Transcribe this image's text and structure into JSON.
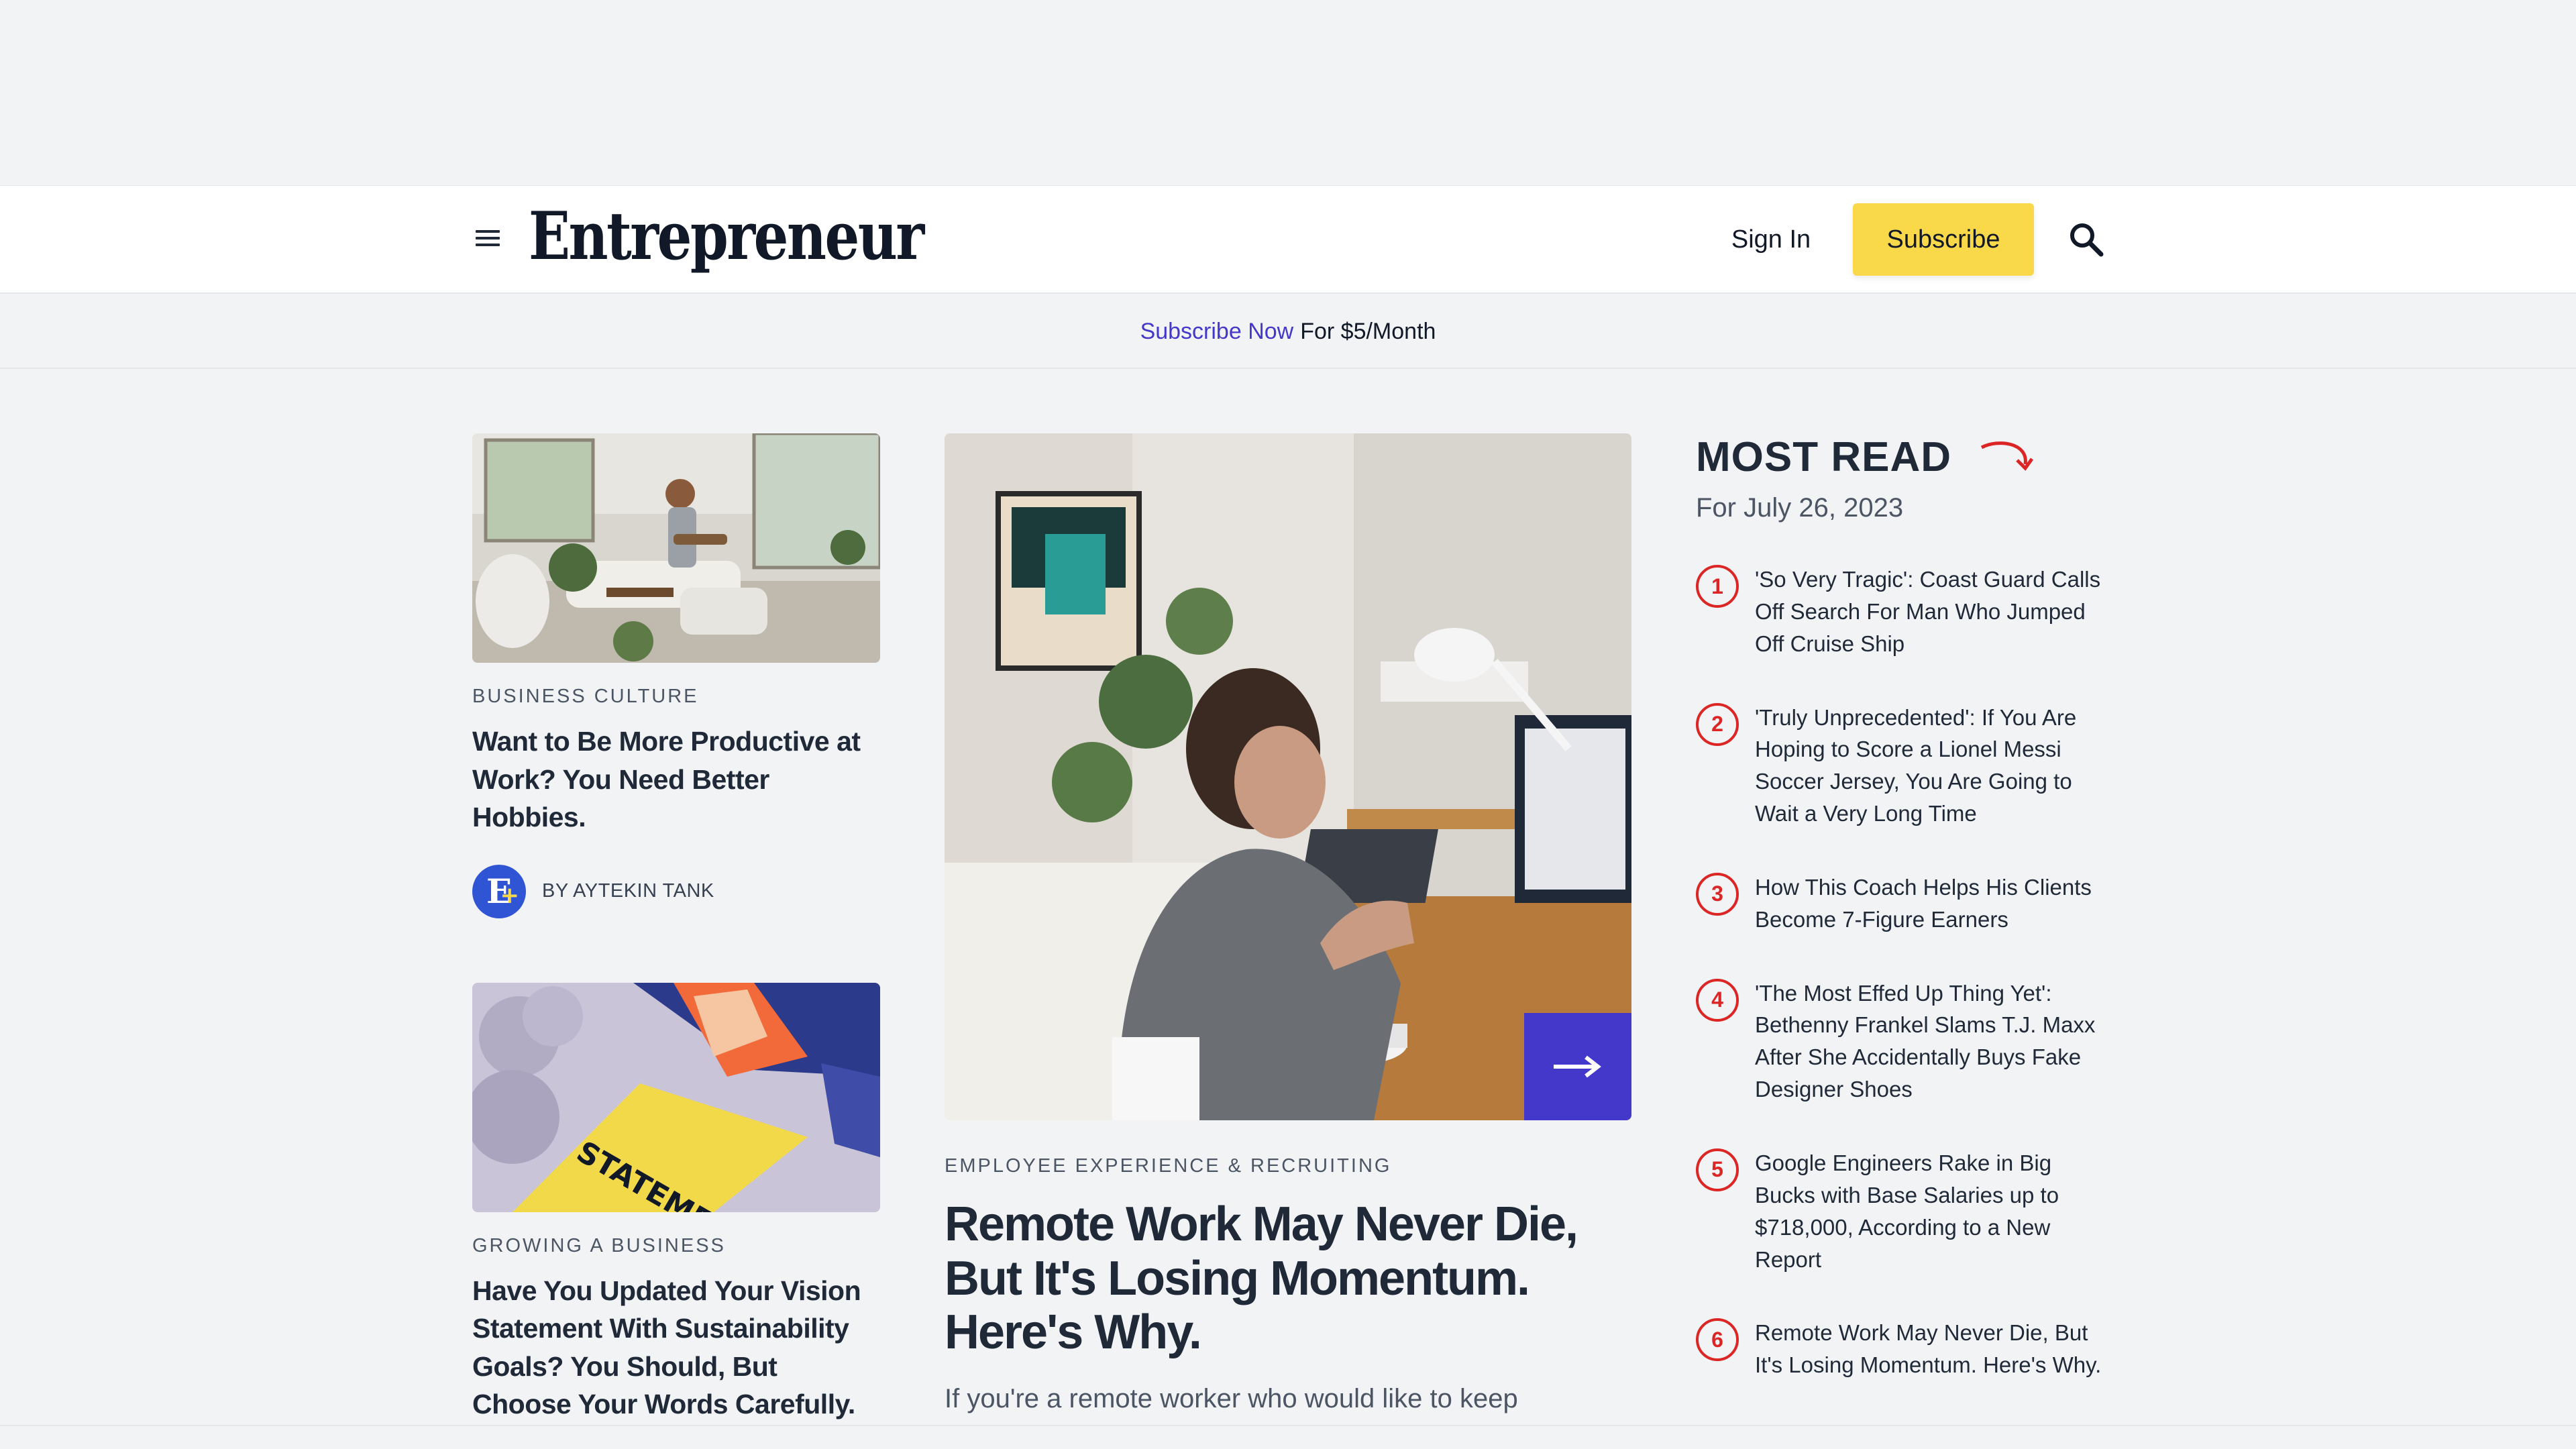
{
  "header": {
    "logo": "Entrepreneur",
    "sign_in": "Sign In",
    "subscribe": "Subscribe"
  },
  "promo": {
    "link": "Subscribe Now",
    "text": "For $5/Month"
  },
  "left_cards": [
    {
      "category": "BUSINESS CULTURE",
      "title": "Want to Be More Productive at Work? You Need Better Hobbies.",
      "byline": "BY AYTEKIN TANK"
    },
    {
      "category": "GROWING A BUSINESS",
      "title": "Have You Updated Your Vision Statement With Sustainability Goals? You Should, But Choose Your Words Carefully.",
      "image_text": "STATEMENT"
    }
  ],
  "hero": {
    "category": "EMPLOYEE EXPERIENCE & RECRUITING",
    "title": "Remote Work May Never Die, But It's Losing Momentum. Here's Why.",
    "description": "If you're a remote worker who would like to keep"
  },
  "most_read": {
    "title": "MOST READ",
    "date": "For July 26, 2023",
    "items": [
      {
        "num": "1",
        "text": "'So Very Tragic': Coast Guard Calls Off Search For Man Who Jumped Off Cruise Ship"
      },
      {
        "num": "2",
        "text": "'Truly Unprecedented': If You Are Hoping to Score a Lionel Messi Soccer Jersey, You Are Going to Wait a Very Long Time"
      },
      {
        "num": "3",
        "text": "How This Coach Helps His Clients Become 7-Figure Earners"
      },
      {
        "num": "4",
        "text": "'The Most Effed Up Thing Yet': Bethenny Frankel Slams T.J. Maxx After She Accidentally Buys Fake Designer Shoes"
      },
      {
        "num": "5",
        "text": "Google Engineers Rake in Big Bucks with Base Salaries up to $718,000, According to a New Report"
      },
      {
        "num": "6",
        "text": "Remote Work May Never Die, But It's Losing Momentum. Here's Why."
      }
    ]
  },
  "colors": {
    "accent": "#4338ca",
    "subscribe_bg": "#f9d94a",
    "most_read_number": "#dc2626"
  }
}
